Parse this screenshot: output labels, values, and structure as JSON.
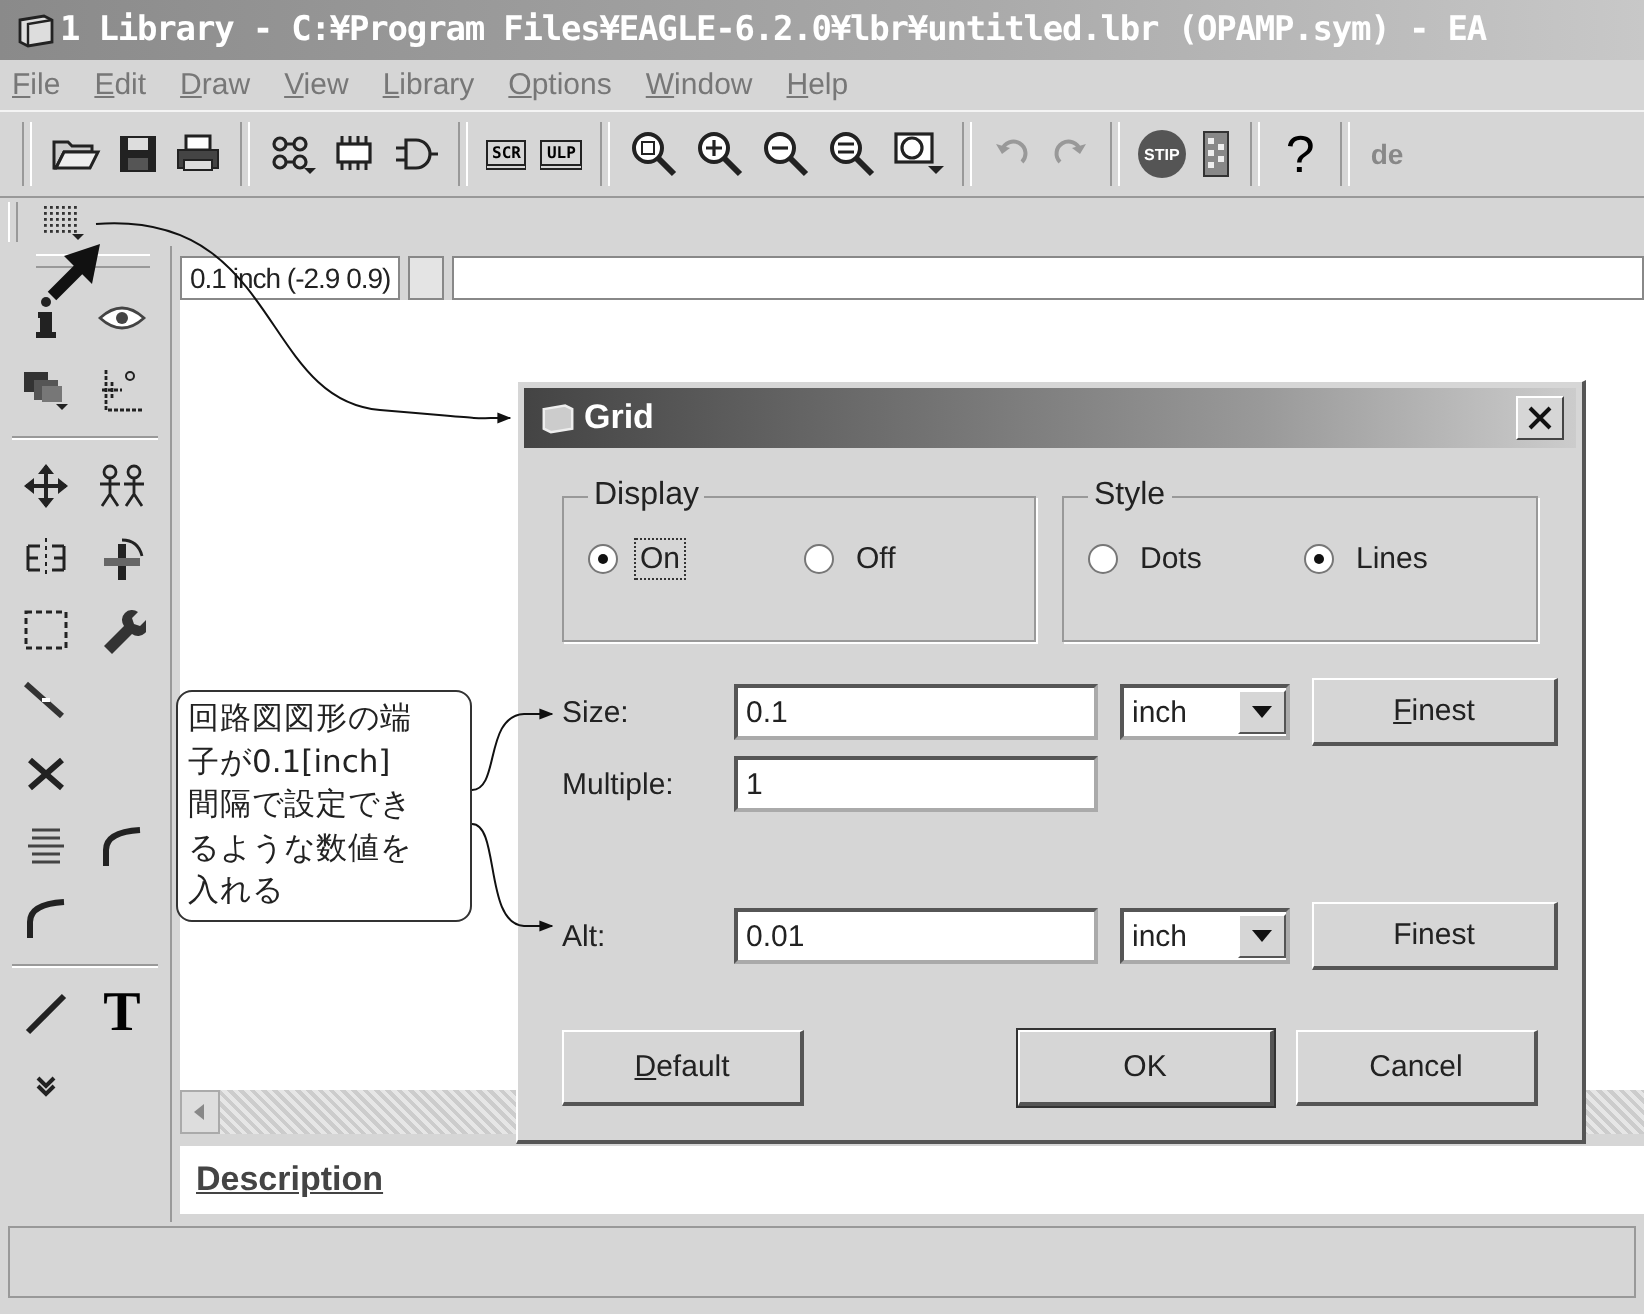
{
  "window": {
    "title": "1 Library - C:¥Program Files¥EAGLE-6.2.0¥lbr¥untitled.lbr (OPAMP.sym) - EA"
  },
  "menu": [
    {
      "label": "File"
    },
    {
      "label": "Edit"
    },
    {
      "label": "Draw"
    },
    {
      "label": "View"
    },
    {
      "label": "Library"
    },
    {
      "label": "Options"
    },
    {
      "label": "Window"
    },
    {
      "label": "Help"
    }
  ],
  "toolbar": {
    "items": [
      {
        "kind": "sep"
      },
      {
        "kind": "open"
      },
      {
        "kind": "save"
      },
      {
        "kind": "print"
      },
      {
        "kind": "sep"
      },
      {
        "kind": "schematic"
      },
      {
        "kind": "chip"
      },
      {
        "kind": "gate"
      },
      {
        "kind": "sep"
      },
      {
        "kind": "script",
        "label": "SCR"
      },
      {
        "kind": "script",
        "label": "ULP"
      },
      {
        "kind": "sep"
      },
      {
        "kind": "zoom"
      },
      {
        "kind": "zoomin"
      },
      {
        "kind": "zoomout"
      },
      {
        "kind": "zoomfit"
      },
      {
        "kind": "zoomsel"
      },
      {
        "kind": "sep"
      },
      {
        "kind": "undo"
      },
      {
        "kind": "redo"
      },
      {
        "kind": "sep"
      },
      {
        "kind": "stop",
        "label": "STIP"
      },
      {
        "kind": "go"
      },
      {
        "kind": "sep"
      },
      {
        "kind": "help",
        "label": "?"
      },
      {
        "kind": "sep"
      }
    ],
    "cut_text": "de"
  },
  "palette": [
    [
      {
        "kind": "info"
      },
      {
        "kind": "eye"
      }
    ],
    [
      {
        "kind": "layers"
      },
      {
        "kind": "mark"
      }
    ],
    [
      {
        "kind": "divider"
      }
    ],
    [
      {
        "kind": "move"
      },
      {
        "kind": "copy"
      }
    ],
    [
      {
        "kind": "mirror"
      },
      {
        "kind": "rotate"
      }
    ],
    [
      {
        "kind": "group"
      },
      {
        "kind": "wrench"
      }
    ],
    [
      {
        "kind": "cut"
      }
    ],
    [
      {
        "kind": "delete"
      }
    ],
    [
      {
        "kind": "value"
      },
      {
        "kind": "arc"
      }
    ],
    [
      {
        "kind": "arc"
      }
    ],
    [
      {
        "kind": "divider"
      }
    ],
    [
      {
        "kind": "line"
      },
      {
        "kind": "text",
        "label": "T"
      }
    ],
    [
      {
        "kind": "more"
      }
    ]
  ],
  "grid_status": "0.1 inch (-2.9 0.9)",
  "description": {
    "label": "Description"
  },
  "dialog": {
    "title": "Grid",
    "display": {
      "label": "Display",
      "options": [
        {
          "label": "On",
          "selected": true,
          "focused": true
        },
        {
          "label": "Off",
          "selected": false,
          "focused": false
        }
      ]
    },
    "style": {
      "label": "Style",
      "options": [
        {
          "label": "Dots",
          "selected": false
        },
        {
          "label": "Lines",
          "selected": true
        }
      ]
    },
    "size": {
      "label": "Size:",
      "value": "0.1",
      "unit": "inch",
      "button": {
        "label": "Finest",
        "mnemonic": true
      }
    },
    "multiple": {
      "label": "Multiple:",
      "value": "1"
    },
    "alt": {
      "label": "Alt:",
      "value": "0.01",
      "unit": "inch",
      "button": {
        "label": "Finest",
        "mnemonic": false
      }
    },
    "buttons": [
      {
        "label": "Default",
        "mnemonic": true,
        "default": false
      },
      {
        "label": "OK",
        "mnemonic": false,
        "default": true
      },
      {
        "label": "Cancel",
        "mnemonic": false,
        "default": false
      }
    ]
  },
  "callout": {
    "text": "回路図図形の端子が0.1[inch]間隔で設定できるような数値を入れる"
  }
}
